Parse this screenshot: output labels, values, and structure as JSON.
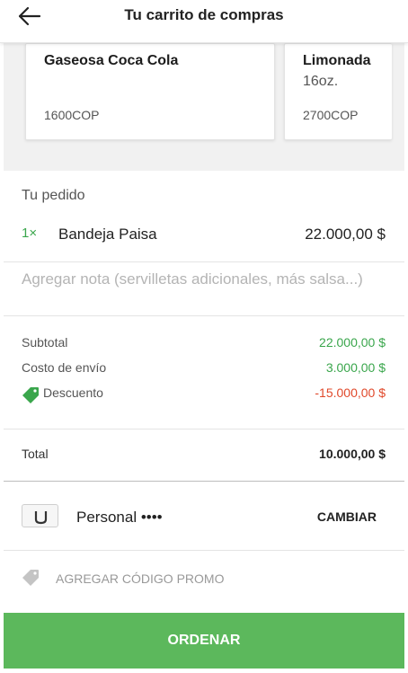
{
  "header": {
    "title": "Tu carrito de compras"
  },
  "suggestions": [
    {
      "name": "Gaseosa Coca Cola",
      "subtitle": "",
      "price": "1600COP"
    },
    {
      "name": "Limonada",
      "subtitle": "16oz.",
      "price": "2700COP"
    }
  ],
  "order": {
    "section_label": "Tu pedido",
    "items": [
      {
        "qty": "1×",
        "name": "Bandeja Paisa",
        "price": "22.000,00 $"
      }
    ],
    "note_placeholder": "Agregar nota (servilletas adicionales, más salsa...)"
  },
  "summary": {
    "subtotal_label": "Subtotal",
    "subtotal_value": "22.000,00 $",
    "shipping_label": "Costo de envío",
    "shipping_value": "3.000,00 $",
    "discount_label": "Descuento",
    "discount_value": "-15.000,00 $",
    "total_label": "Total",
    "total_value": "10.000,00 $"
  },
  "payment": {
    "label": "Personal ••••",
    "change_label": "CAMBIAR"
  },
  "promo": {
    "label": "AGREGAR CÓDIGO PROMO"
  },
  "cta": {
    "label": "ORDENAR"
  },
  "colors": {
    "accent_green": "#5cb85c",
    "value_green": "#3aa64c",
    "discount_red": "#e0482a"
  },
  "icons": {
    "back": "arrow-left-icon",
    "discount": "tag-icon",
    "payment": "uber-cash-icon",
    "promo": "tag-icon"
  }
}
